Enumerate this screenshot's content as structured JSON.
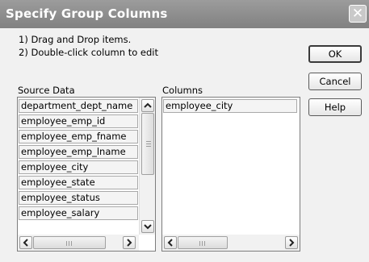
{
  "window": {
    "title": "Specify Group Columns",
    "close_symbol": "✕"
  },
  "instructions": {
    "line1": "1) Drag and Drop items.",
    "line2": "2) Double-click column to edit"
  },
  "buttons": {
    "ok": "OK",
    "cancel": "Cancel",
    "help": "Help"
  },
  "source": {
    "label": "Source Data",
    "items": [
      "department_dept_name",
      "employee_emp_id",
      "employee_emp_fname",
      "employee_emp_lname",
      "employee_city",
      "employee_state",
      "employee_status",
      "employee_salary"
    ]
  },
  "columns": {
    "label": "Columns",
    "items": [
      "employee_city"
    ]
  },
  "icons": {
    "up": "scroll-up-icon",
    "down": "scroll-down-icon",
    "left": "scroll-left-icon",
    "right": "scroll-right-icon",
    "close": "close-icon"
  }
}
